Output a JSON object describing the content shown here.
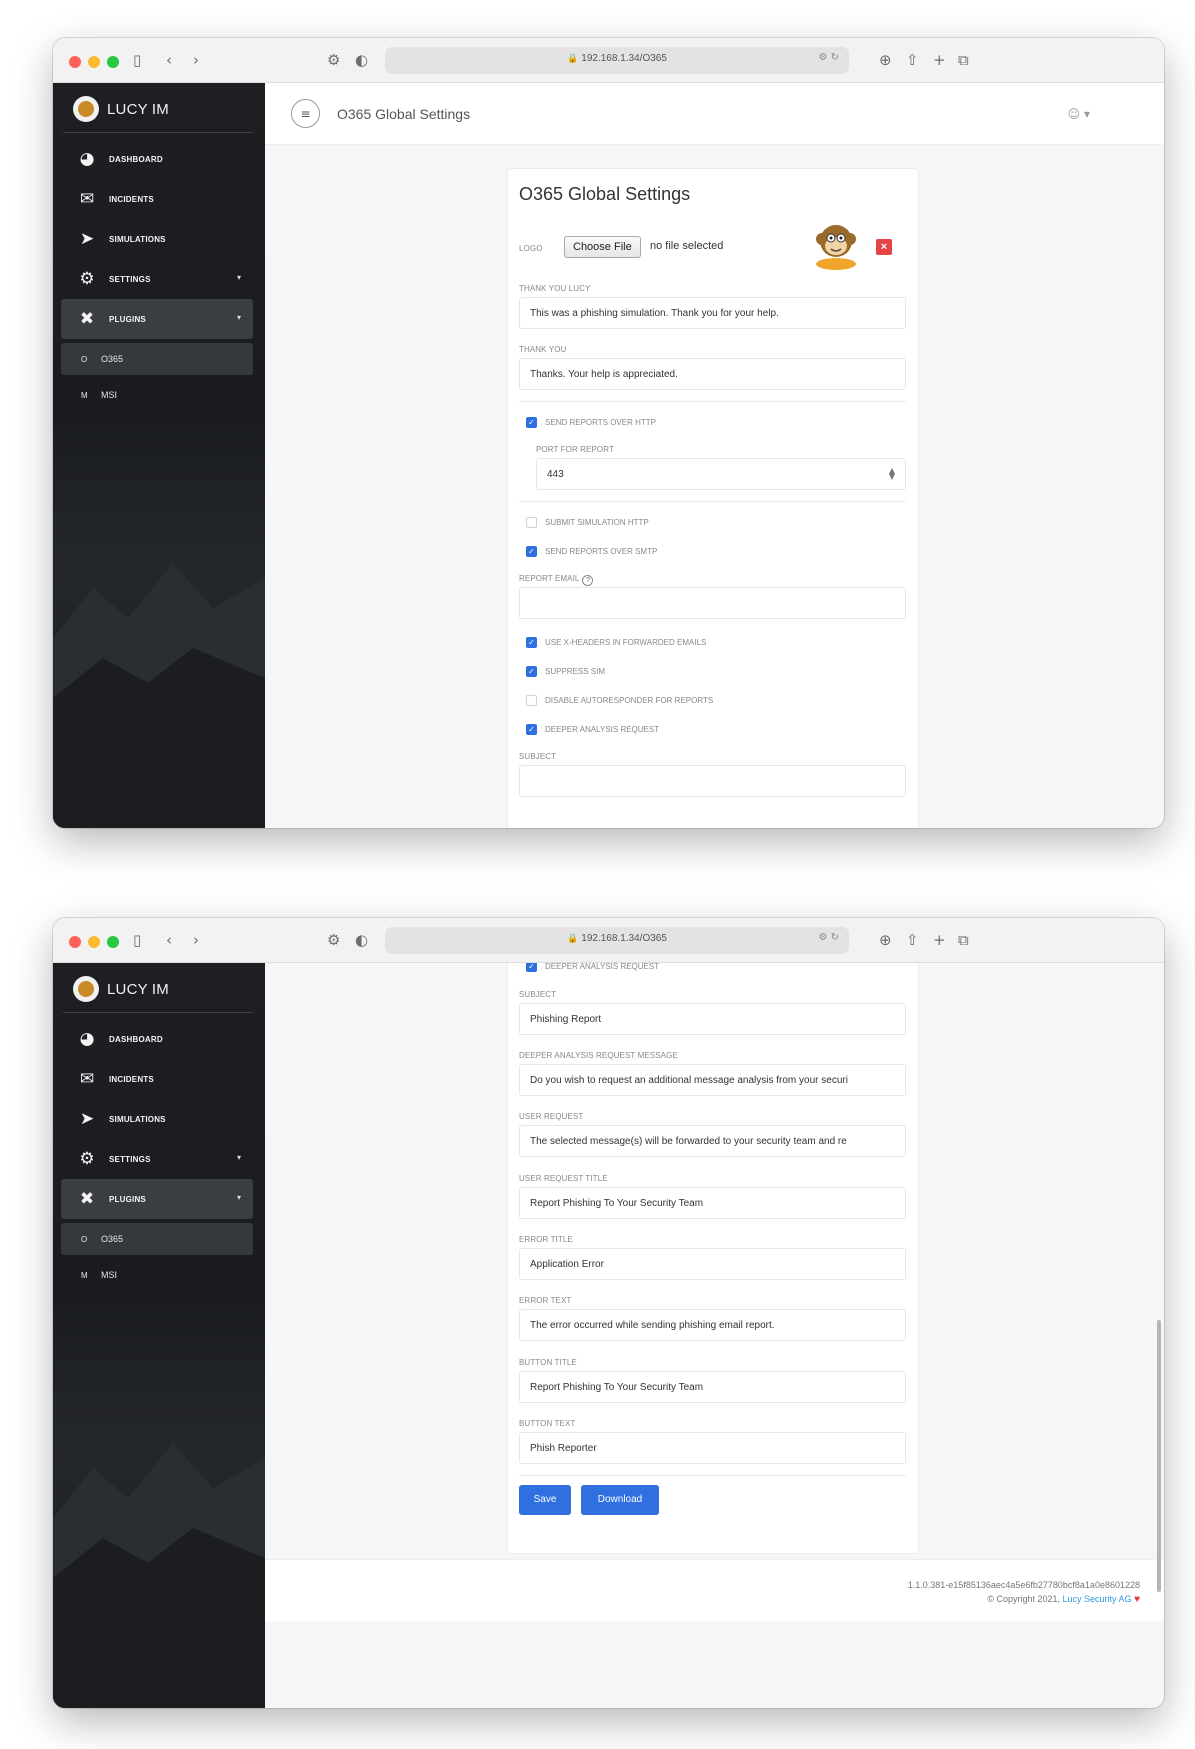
{
  "browser": {
    "url": "192.168.1.34/O365",
    "lock_glyph": "🔒",
    "url_right_icons": "⚙ ↻"
  },
  "sidebar": {
    "brand": "LUCY IM",
    "items": [
      {
        "label": "DASHBOARD",
        "icon": "pie-chart-icon"
      },
      {
        "label": "INCIDENTS",
        "icon": "envelope-icon"
      },
      {
        "label": "SIMULATIONS",
        "icon": "paper-plane-icon"
      },
      {
        "label": "SETTINGS",
        "icon": "gears-icon"
      },
      {
        "label": "PLUGINS",
        "icon": "tools-icon"
      }
    ],
    "sub_items": [
      {
        "letter": "O",
        "label": "O365"
      },
      {
        "letter": "M",
        "label": "MSI"
      }
    ]
  },
  "header": {
    "title": "O365 Global Settings",
    "menu_glyph": "≡",
    "user_glyph": "☺ ▾"
  },
  "form": {
    "title": "O365 Global Settings",
    "logo_label": "LOGO",
    "choose_file": "Choose File",
    "file_status": "no file selected",
    "remove_glyph": "×",
    "thank_you_lucy_label": "THANK YOU LUCY",
    "thank_you_lucy_value": "This was a phishing simulation. Thank you for your help.",
    "thank_you_label": "THANK YOU",
    "thank_you_value": "Thanks. Your help is appreciated.",
    "send_http_label": "SEND REPORTS OVER HTTP",
    "send_http_checked": true,
    "port_label": "PORT FOR REPORT",
    "port_value": "443",
    "submit_sim_label": "SUBMIT SIMULATION HTTP",
    "submit_sim_checked": false,
    "send_smtp_label": "SEND REPORTS OVER SMTP",
    "send_smtp_checked": true,
    "report_email_label": "REPORT EMAIL",
    "help_glyph": "?",
    "report_email_value": "",
    "xheaders_label": "USE X-HEADERS IN FORWARDED EMAILS",
    "xheaders_checked": true,
    "suppress_sim_label": "SUPPRESS SIM",
    "suppress_sim_checked": true,
    "disable_auto_label": "DISABLE AUTORESPONDER FOR REPORTS",
    "disable_auto_checked": false,
    "deeper_label": "DEEPER ANALYSIS REQUEST",
    "deeper_checked": true,
    "subject_label": "SUBJECT",
    "subject_value": "Phishing Report",
    "deeper_msg_label": "DEEPER ANALYSIS REQUEST MESSAGE",
    "deeper_msg_value": "Do you wish to request an additional message analysis from your securi",
    "user_request_label": "USER REQUEST",
    "user_request_value": "The selected message(s) will be forwarded to your security team and re",
    "user_request_title_label": "USER REQUEST TITLE",
    "user_request_title_value": "Report Phishing To Your Security Team",
    "error_title_label": "ERROR TITLE",
    "error_title_value": "Application Error",
    "error_text_label": "ERROR TEXT",
    "error_text_value": "The error occurred while sending phishing email report.",
    "button_title_label": "BUTTON TITLE",
    "button_title_value": "Report Phishing To Your Security Team",
    "button_text_label": "BUTTON TEXT",
    "button_text_value": "Phish Reporter",
    "save": "Save",
    "download": "Download"
  },
  "footer": {
    "version": "1.1.0.381-e15f85136aec4a5e6fb27780bcf8a1a0e8601228",
    "copyright_prefix": "© Copyright 2021,",
    "company": "Lucy Security AG",
    "heart": "♥"
  },
  "colors": {
    "accent": "#2f6fe0",
    "sidebar_bg": "#1d1f23",
    "danger": "#e64545"
  }
}
